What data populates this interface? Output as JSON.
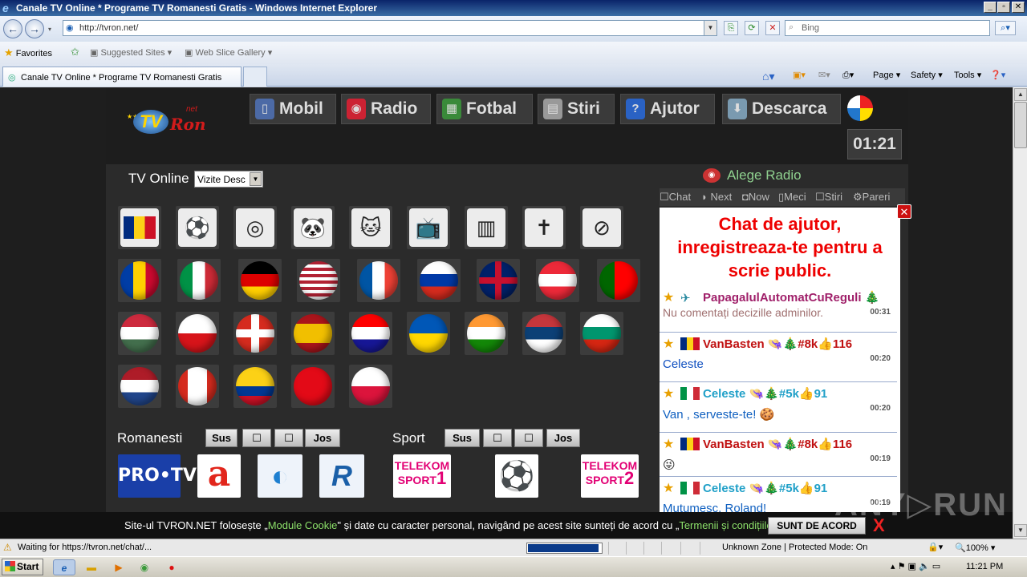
{
  "window": {
    "title": "Canale TV Online * Programe TV Romanesti Gratis - Windows Internet Explorer",
    "controls": [
      "_",
      "▫",
      "✕"
    ]
  },
  "address_bar": {
    "url": "http://tvron.net/",
    "search_placeholder": "Bing"
  },
  "favorites_bar": {
    "favorites_label": "Favorites",
    "items": [
      "Suggested Sites ▾",
      "Web Slice Gallery ▾"
    ]
  },
  "tab": {
    "title": "Canale TV Online * Programe TV Romanesti Gratis"
  },
  "command_bar": {
    "page": "Page ▾",
    "safety": "Safety ▾",
    "tools": "Tools ▾"
  },
  "site": {
    "menu": [
      {
        "label": "Mobil",
        "icon": "phone-icon",
        "glyph": "▯",
        "color": "#4c6aa6"
      },
      {
        "label": "Radio",
        "icon": "radio-icon",
        "glyph": "◉",
        "color": "#c23"
      },
      {
        "label": "Fotbal",
        "icon": "football-field-icon",
        "glyph": "▦",
        "color": "#3a8a3a"
      },
      {
        "label": "Stiri",
        "icon": "newspaper-icon",
        "glyph": "▤",
        "color": "#999"
      },
      {
        "label": "Ajutor",
        "icon": "help-icon",
        "glyph": "?",
        "color": "#2a62c4"
      },
      {
        "label": "Descarca",
        "icon": "download-icon",
        "glyph": "⬇",
        "color": "#7a9ab0"
      }
    ],
    "clock": "01:21",
    "tv_online_label": "TV Online",
    "sort_select_value": "Vizite Desc",
    "categories": [
      "romania-map",
      "football",
      "film-reel",
      "panda",
      "cartoon",
      "tv-24",
      "city-buildings",
      "crucifix",
      "music-tv"
    ],
    "countries": [
      "moldova",
      "italy",
      "germany",
      "usa",
      "france",
      "russia",
      "uk",
      "austria",
      "portugal",
      "hungary",
      "czech",
      "switzerland",
      "spain",
      "croatia",
      "ukraine",
      "india",
      "serbia",
      "bulgaria",
      "netherlands",
      "canada",
      "colombia",
      "turkey",
      "poland"
    ],
    "romanesti": {
      "title": "Romanesti",
      "buttons": [
        "Sus",
        "☐",
        "☐",
        "Jos"
      ],
      "channels": [
        "PRO•TV",
        "a",
        "◐",
        "R"
      ]
    },
    "sport": {
      "title": "Sport",
      "buttons": [
        "Sus",
        "☐",
        "☐",
        "Jos"
      ],
      "channels": [
        {
          "l1": "TELEKOM",
          "l2": "SPORT",
          "n": "1"
        },
        {
          "l1": "⚽",
          "l2": "",
          "n": ""
        },
        {
          "l1": "TELEKOM",
          "l2": "SPORT",
          "n": "2"
        }
      ]
    },
    "radio_label": "Alege Radio",
    "chat_tabs": [
      "☐Chat",
      "◗ Next",
      "◘Now",
      "▯Meci",
      "☐Stiri",
      "⚙Pareri"
    ],
    "chat_heading": "Chat de ajutor, inregistreaza-te pentru a scrie public.",
    "messages": [
      {
        "user": "PapagalulAutomatCuReguli 🎄",
        "user_color": "#a0206a",
        "text": "Nu comentați decizille adminilor.",
        "text_color": "#a07070",
        "time": "00:31",
        "flag": "bot"
      },
      {
        "user": "VanBasten 👒🎄#8k👍116",
        "user_color": "#c01010",
        "text": "Celeste",
        "text_color": "#1050c0",
        "time": "00:20",
        "flag": "ro"
      },
      {
        "user": "Celeste 👒🎄#5k👍91",
        "user_color": "#20a0c8",
        "text": "Van                   , serveste-te! 🍪",
        "text_color": "#1060c0",
        "time": "00:20",
        "flag": "it"
      },
      {
        "user": "VanBasten 👒🎄#8k👍116",
        "user_color": "#c01010",
        "text": "😜",
        "text_color": "#333",
        "time": "00:19",
        "flag": "ro"
      },
      {
        "user": "Celeste 👒🎄#5k👍91",
        "user_color": "#20a0c8",
        "text": "Mutumesc, Roland!",
        "text_color": "#1060c0",
        "time": "00:19",
        "flag": "it"
      }
    ],
    "cookie": {
      "before": "Site-ul TVRON.NET folosește „",
      "link1": "Module Cookie",
      "middle": "\" și date cu caracter personal, navigând pe acest site sunteți de acord cu „",
      "link2": "Termenii și condițiile",
      "after": "\".",
      "accept": "SUNT DE ACORD",
      "close": "X"
    },
    "watermark": "ANY▷RUN"
  },
  "status_bar": {
    "text": "Waiting for https://tvron.net/chat/...",
    "progress": 0.95,
    "zone": "Unknown Zone | Protected Mode: On",
    "zoom": "🔍100% ▾"
  },
  "taskbar": {
    "start": "Start",
    "clock": "11:21 PM"
  }
}
